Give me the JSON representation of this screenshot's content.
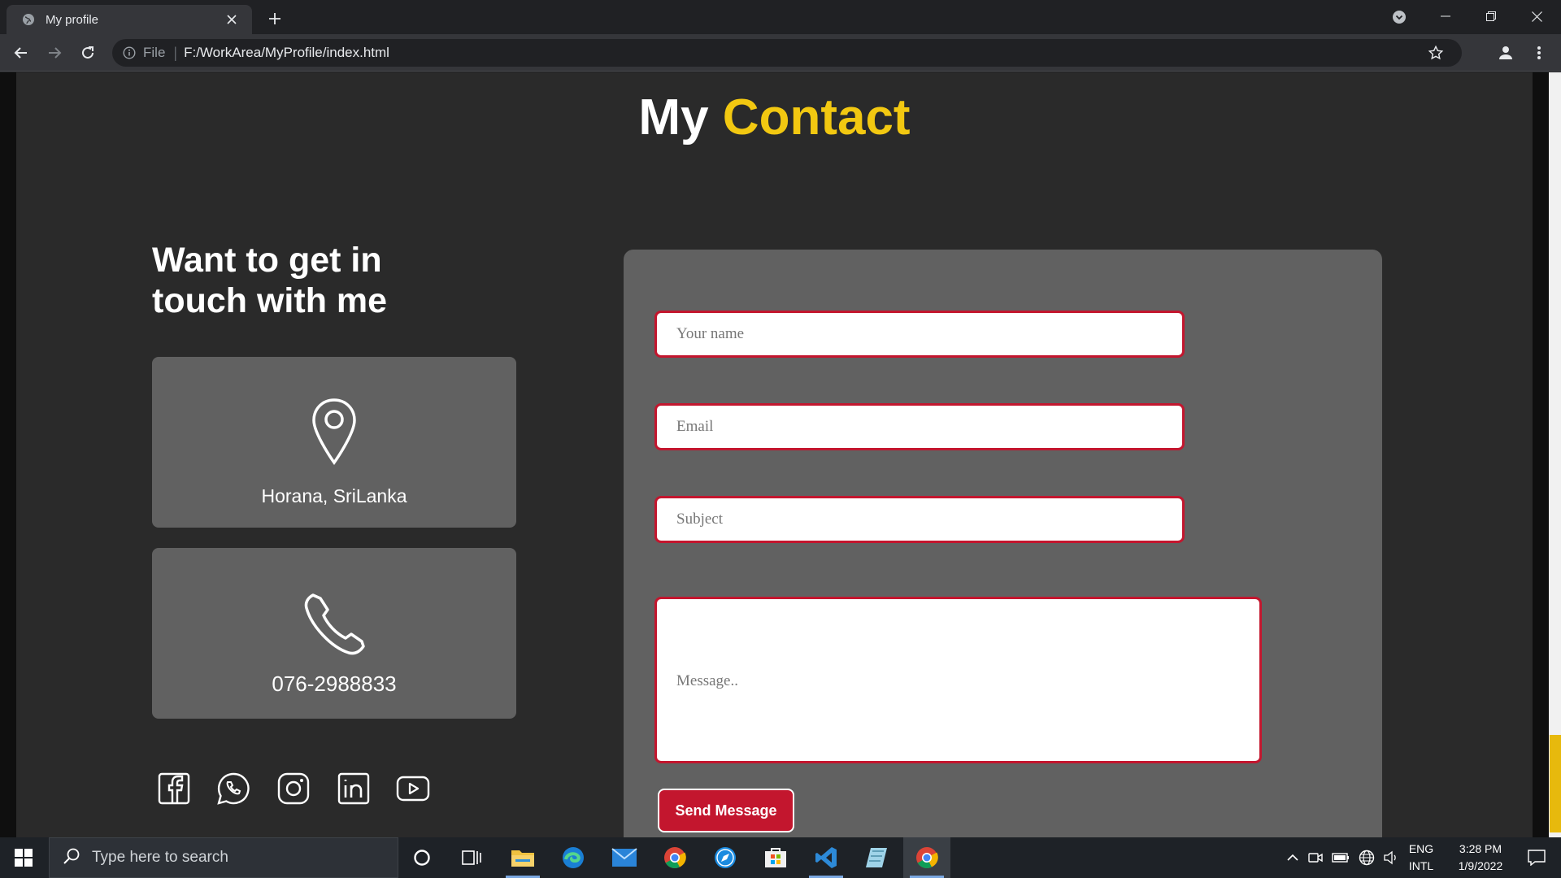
{
  "browser": {
    "tab_title": "My profile",
    "scheme_label": "File",
    "url": "F:/WorkArea/MyProfile/index.html"
  },
  "page": {
    "heading_plain": "My",
    "heading_accent": "Contact",
    "touch_heading": "Want to get in touch with me",
    "address": "Horana, SriLanka",
    "phone": "076-2988833",
    "colors": {
      "background": "#2a2a2a",
      "card": "#616161",
      "accent": "#f2c811",
      "button": "#c3162e"
    },
    "social_icons": [
      "facebook-icon",
      "whatsapp-icon",
      "instagram-icon",
      "linkedin-icon",
      "youtube-icon"
    ]
  },
  "form": {
    "name_placeholder": "Your name",
    "email_placeholder": "Email",
    "subject_placeholder": "Subject",
    "message_placeholder": "Message..",
    "send_label": "Send Message"
  },
  "taskbar": {
    "search_placeholder": "Type here to search",
    "language_top": "ENG",
    "language_bottom": "INTL",
    "time": "3:28 PM",
    "date": "1/9/2022"
  }
}
